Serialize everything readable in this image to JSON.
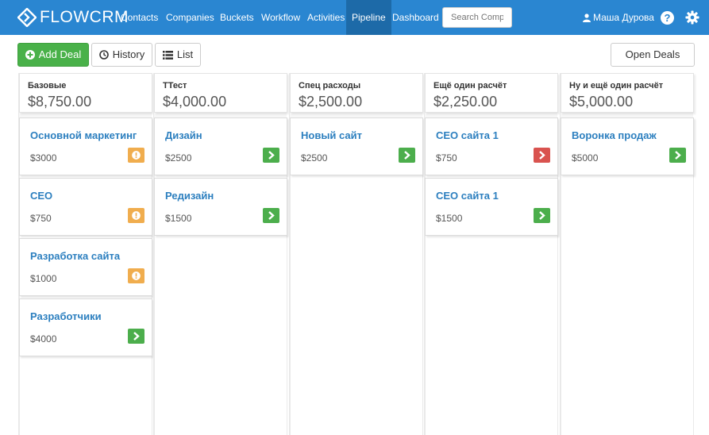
{
  "brand": {
    "name": "FLOWCRM"
  },
  "nav": {
    "items": [
      {
        "label": "Contacts"
      },
      {
        "label": "Companies"
      },
      {
        "label": "Buckets"
      },
      {
        "label": "Workflow"
      },
      {
        "label": "Activities"
      },
      {
        "label": "Pipeline",
        "active": true
      },
      {
        "label": "Dashboard"
      }
    ],
    "search_placeholder": "Search Comp",
    "user_name": "Маша Дурова",
    "help_icon": "question-circle-icon",
    "settings_icon": "gear-icon"
  },
  "toolbar": {
    "add_deal": "Add Deal",
    "history": "History",
    "list": "List",
    "open_deals": "Open Deals"
  },
  "colors": {
    "navbar": "#2a86d1",
    "active_nav": "#1d6aa8",
    "add_button": "#49b149",
    "link": "#2c7fbf",
    "warn": "#f0ad4e",
    "success": "#4cae4c",
    "danger": "#d9534f"
  },
  "columns": [
    {
      "title": "Базовые",
      "total": "$8,750.00",
      "cards": [
        {
          "title": "Основной маркетинг",
          "amount": "$3000",
          "status": "warn"
        },
        {
          "title": "СЕО",
          "amount": "$750",
          "status": "warn"
        },
        {
          "title": "Разработка сайта",
          "amount": "$1000",
          "status": "warn"
        },
        {
          "title": "Разработчики",
          "amount": "$4000",
          "status": "go"
        }
      ]
    },
    {
      "title": "ТТест",
      "total": "$4,000.00",
      "cards": [
        {
          "title": "Дизайн",
          "amount": "$2500",
          "status": "go"
        },
        {
          "title": "Редизайн",
          "amount": "$1500",
          "status": "go"
        }
      ]
    },
    {
      "title": "Спец расходы",
      "total": "$2,500.00",
      "cards": [
        {
          "title": "Новый сайт",
          "amount": "$2500",
          "status": "go"
        }
      ]
    },
    {
      "title": "Ещё один расчёт",
      "total": "$2,250.00",
      "cards": [
        {
          "title": "СЕО сайта 1",
          "amount": "$750",
          "status": "bad"
        },
        {
          "title": "СЕО сайта 1",
          "amount": "$1500",
          "status": "go"
        }
      ]
    },
    {
      "title": "Ну и ещё один расчёт",
      "total": "$5,000.00",
      "cards": [
        {
          "title": "Воронка продаж",
          "amount": "$5000",
          "status": "go"
        }
      ]
    }
  ]
}
